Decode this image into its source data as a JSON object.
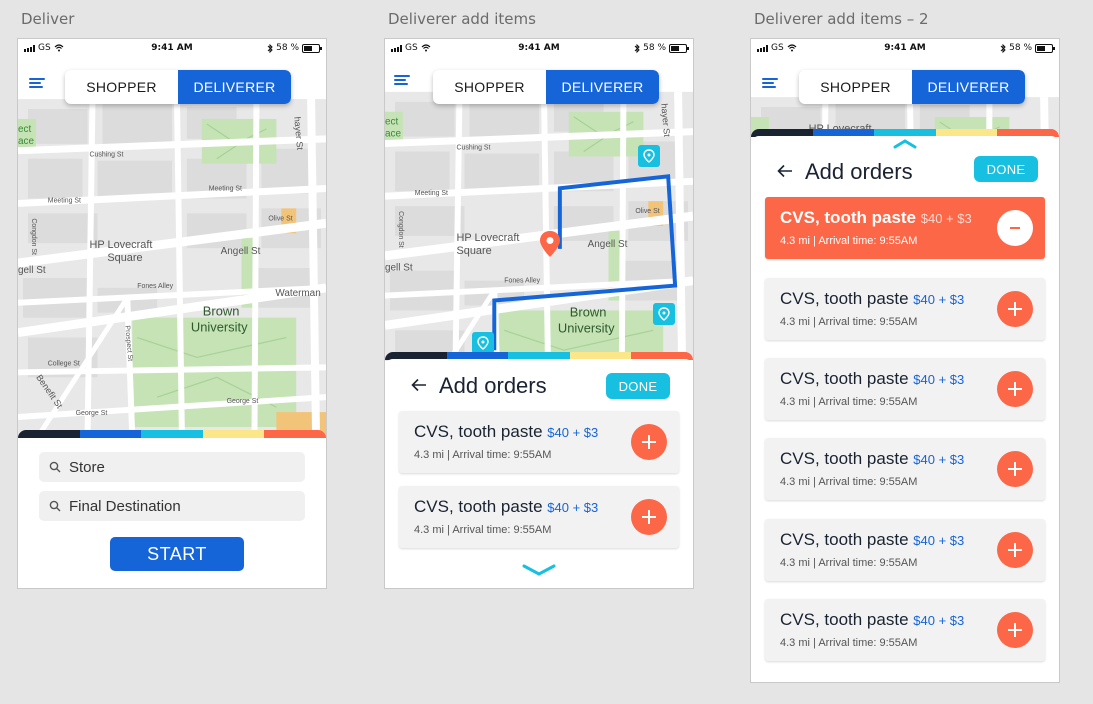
{
  "colors": {
    "blue": "#1565d8",
    "orange": "#fc6748",
    "cyan": "#17c0e0",
    "navy": "#1a2332",
    "bar_segments": [
      "#1a2332",
      "#1565d8",
      "#17c0e0",
      "#fbe78a",
      "#fc6748"
    ]
  },
  "status_bar": {
    "carrier": "GS",
    "time": "9:41 AM",
    "battery": "58 %",
    "icons": [
      "signal-bars-icon",
      "wifi-icon",
      "bluetooth-icon",
      "battery-icon"
    ]
  },
  "toggle": {
    "shopper": "SHOPPER",
    "deliverer": "DELIVERER",
    "selected": "deliverer"
  },
  "map_labels": {
    "cushing": "Cushing St",
    "meeting": "Meeting St",
    "olive": "Olive St",
    "hp1": "HP Lovecraft",
    "hp2": "Square",
    "angell": "Angell St",
    "angell_left": "gell St",
    "fones": "Fones Alley",
    "brown1": "Brown",
    "brown2": "University",
    "waterman": "Waterman",
    "thayer": "hayer St",
    "college": "College St",
    "prospect": "Prospect St",
    "benefit": "Benefit St",
    "george": "George St",
    "congdon": "Congdon St",
    "poi1": "ect",
    "poi2": "ace"
  },
  "screens": [
    {
      "title": "Deliver",
      "store_placeholder": "Store",
      "destination_placeholder": "Final Destination",
      "start_label": "START"
    },
    {
      "title": "Deliverer add items",
      "heading": "Add orders",
      "done_label": "DONE",
      "orders": [
        {
          "name": "CVS, tooth paste",
          "price": "$40 + $3",
          "distance": "4.3 mi",
          "arrival": "Arrival time: 9:55AM",
          "selected": false
        },
        {
          "name": "CVS, tooth paste",
          "price": "$40 + $3",
          "distance": "4.3 mi",
          "arrival": "Arrival time: 9:55AM",
          "selected": false
        }
      ]
    },
    {
      "title": "Deliverer add items – 2",
      "heading": "Add orders",
      "done_label": "DONE",
      "partial_label": "HP Lovecraft",
      "orders": [
        {
          "name": "CVS, tooth paste",
          "price": "$40 + $3",
          "distance": "4.3 mi",
          "arrival": "Arrival time: 9:55AM",
          "selected": true
        },
        {
          "name": "CVS, tooth paste",
          "price": "$40 + $3",
          "distance": "4.3 mi",
          "arrival": "Arrival time: 9:55AM",
          "selected": false
        },
        {
          "name": "CVS, tooth paste",
          "price": "$40 + $3",
          "distance": "4.3 mi",
          "arrival": "Arrival time: 9:55AM",
          "selected": false
        },
        {
          "name": "CVS, tooth paste",
          "price": "$40 + $3",
          "distance": "4.3 mi",
          "arrival": "Arrival time: 9:55AM",
          "selected": false
        },
        {
          "name": "CVS, tooth paste",
          "price": "$40 + $3",
          "distance": "4.3 mi",
          "arrival": "Arrival time: 9:55AM",
          "selected": false
        },
        {
          "name": "CVS, tooth paste",
          "price": "$40 + $3",
          "distance": "4.3 mi",
          "arrival": "Arrival time: 9:55AM",
          "selected": false
        }
      ]
    }
  ]
}
